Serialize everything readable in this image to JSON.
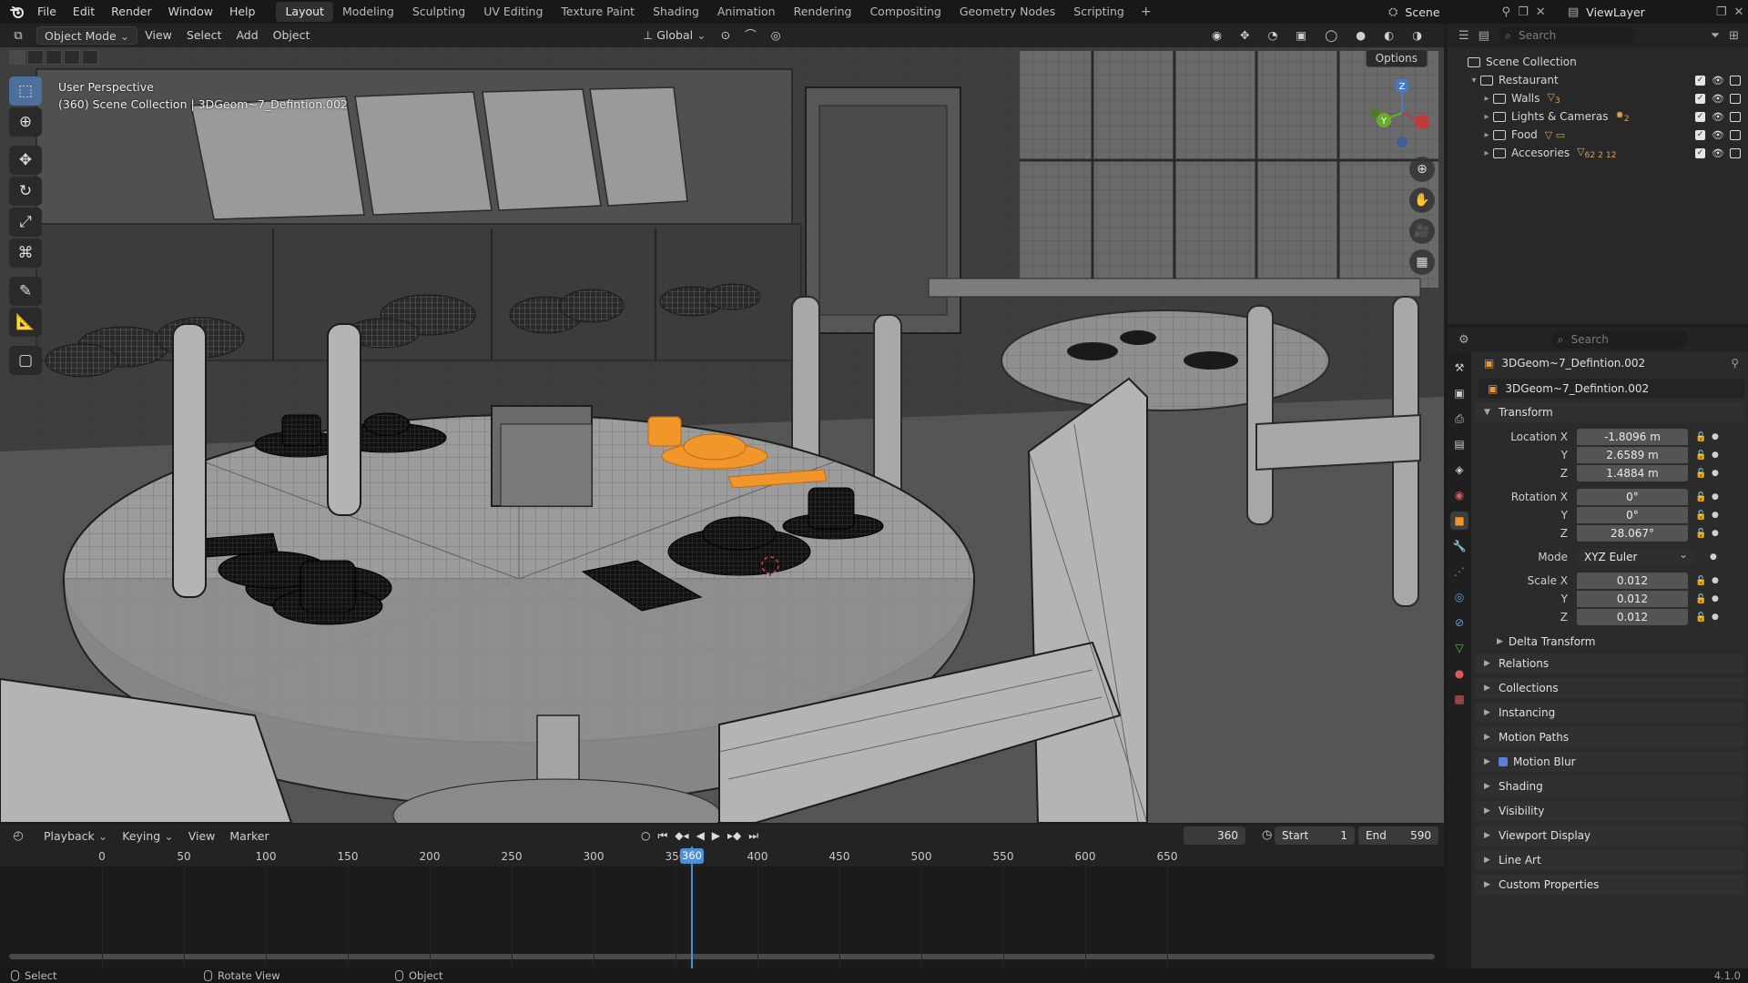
{
  "topbar": {
    "menus": [
      "File",
      "Edit",
      "Render",
      "Window",
      "Help"
    ],
    "workspaces": [
      "Layout",
      "Modeling",
      "Sculpting",
      "UV Editing",
      "Texture Paint",
      "Shading",
      "Animation",
      "Rendering",
      "Compositing",
      "Geometry Nodes",
      "Scripting"
    ],
    "active_workspace": "Layout",
    "add_tab": "+",
    "scene_label": "Scene",
    "view_layer_label": "ViewLayer"
  },
  "viewport": {
    "mode": "Object Mode",
    "menus": [
      "View",
      "Select",
      "Add",
      "Object"
    ],
    "orientation": "Global",
    "options_label": "Options",
    "overlay_line1": "User Perspective",
    "overlay_line2": "(360) Scene Collection | 3DGeom~7_Defintion.002",
    "gizmo_axes": {
      "z": "Z",
      "y": "Y"
    },
    "selected_color": "#f0962b"
  },
  "outliner": {
    "search_placeholder": "Search",
    "root": "Scene Collection",
    "collection": "Restaurant",
    "children": [
      {
        "label": "Walls",
        "sub": "3"
      },
      {
        "label": "Lights & Cameras",
        "sub": "2"
      },
      {
        "label": "Food",
        "sub": ""
      },
      {
        "label": "Accesories",
        "sub": "62 2 12"
      }
    ]
  },
  "properties": {
    "search_placeholder": "Search",
    "object_name": "3DGeom~7_Defintion.002",
    "data_name": "3DGeom~7_Defintion.002",
    "transform_label": "Transform",
    "location_label": "Location X",
    "location": [
      "-1.8096 m",
      "2.6589 m",
      "1.4884 m"
    ],
    "rotation_label": "Rotation X",
    "rotation": [
      "0°",
      "0°",
      "28.067°"
    ],
    "mode_label": "Mode",
    "mode_value": "XYZ Euler",
    "scale_label": "Scale X",
    "scale": [
      "0.012",
      "0.012",
      "0.012"
    ],
    "axis_y": "Y",
    "axis_z": "Z",
    "delta_transform": "Delta Transform",
    "panels": [
      "Relations",
      "Collections",
      "Instancing",
      "Motion Paths",
      "Motion Blur",
      "Shading",
      "Visibility",
      "Viewport Display",
      "Line Art",
      "Custom Properties"
    ]
  },
  "timeline": {
    "menus": [
      "Playback",
      "Keying",
      "View",
      "Marker"
    ],
    "current_frame": "360",
    "start_label": "Start",
    "start_value": "1",
    "end_label": "End",
    "end_value": "590",
    "ruler": [
      "0",
      "50",
      "100",
      "150",
      "200",
      "250",
      "300",
      "350",
      "400",
      "450",
      "500",
      "550",
      "600",
      "650"
    ],
    "playhead_label": "360"
  },
  "statusbar": {
    "select": "Select",
    "rotate": "Rotate View",
    "object": "Object",
    "version": "4.1.0"
  }
}
